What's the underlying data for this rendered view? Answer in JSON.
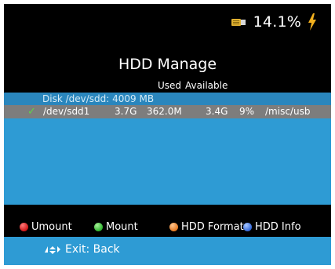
{
  "status": {
    "usage_text": "14.1%",
    "hdd_icon": "hdd-icon",
    "charge_icon": "lightning-icon"
  },
  "title": "HDD Manage",
  "columns": {
    "used": "Used",
    "available": "Available"
  },
  "disk": {
    "label": "Disk /dev/sdd: 4009 MB"
  },
  "partition": {
    "check_icon": "checkmark-icon",
    "check_glyph": "✓",
    "device": "/dev/sdd1",
    "size": "3.7G",
    "used": "362.0M",
    "available": "3.4G",
    "percent": "9%",
    "mount": "/misc/usb"
  },
  "buttons": {
    "umount": {
      "label": "Umount",
      "color": "#e02020"
    },
    "mount": {
      "label": "Mount",
      "color": "#3cc43c"
    },
    "format": {
      "label": "HDD Format",
      "color": "#f08a30"
    },
    "info": {
      "label": "HDD Info",
      "color": "#3f7fe0"
    }
  },
  "footer": {
    "nav_icon": "navigation-arrows-icon",
    "exit_text": "Exit: Back"
  },
  "colors": {
    "accent_blue": "#2e9bd4",
    "selection_gray": "#7d7d7d",
    "header_row_blue": "#2a86bd"
  }
}
